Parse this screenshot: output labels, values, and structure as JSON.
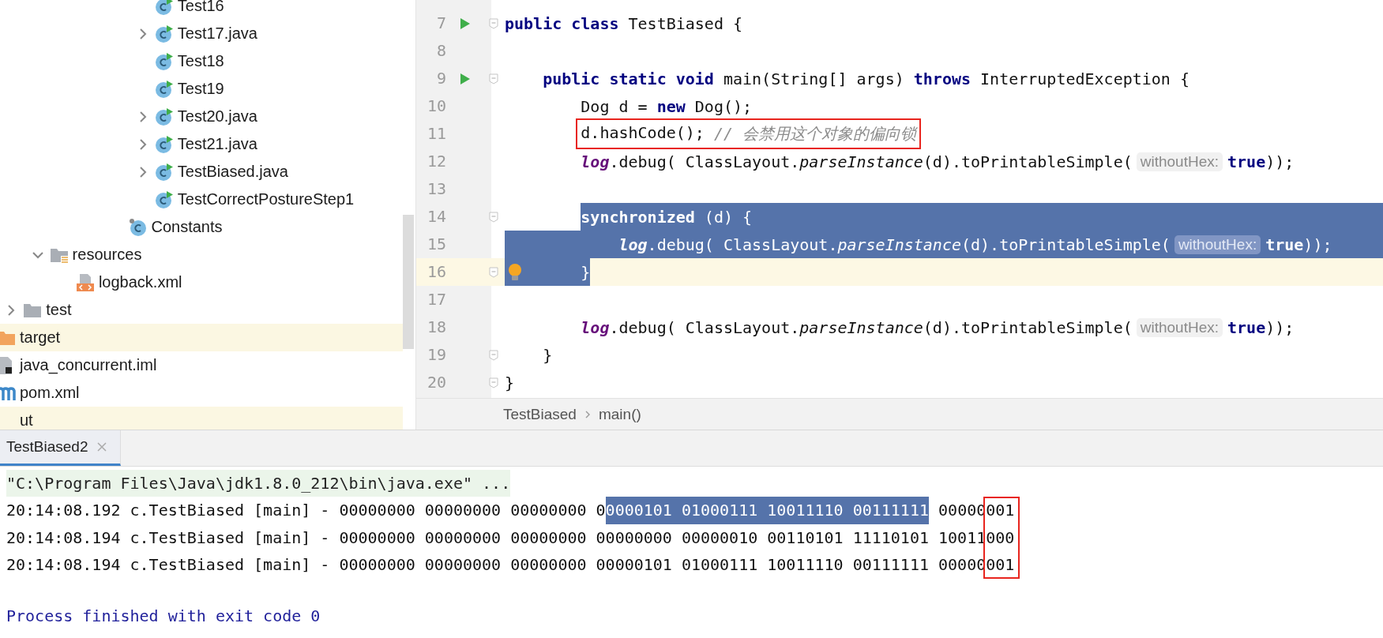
{
  "project_tree": [
    {
      "children": [
        {
          "children": [
            {
              "children": [
                {
                  "children": [
                    {
                      "children": [
                        {
                          "children": [
                            {
                              "label": "Test16",
                              "kind": "runnable-class",
                              "highlighted": false
                            },
                            {
                              "label": "Test17.java",
                              "kind": "runnable-class",
                              "expanded": false,
                              "highlighted": false
                            },
                            {
                              "label": "Test18",
                              "kind": "runnable-class",
                              "highlighted": false
                            },
                            {
                              "label": "Test19",
                              "kind": "runnable-class",
                              "highlighted": false
                            },
                            {
                              "label": "Test20.java",
                              "kind": "runnable-class",
                              "expanded": false,
                              "highlighted": false
                            },
                            {
                              "label": "Test21.java",
                              "kind": "runnable-class",
                              "expanded": false,
                              "highlighted": false
                            },
                            {
                              "label": "TestBiased.java",
                              "kind": "runnable-class",
                              "expanded": false,
                              "highlighted": false
                            },
                            {
                              "label": "TestCorrectPostureStep1",
                              "kind": "runnable-class",
                              "highlighted": false
                            }
                          ]
                        },
                        {
                          "label": "Constants",
                          "kind": "static-class",
                          "highlighted": false
                        }
                      ]
                    }
                  ]
                }
              ]
            },
            {
              "label": "resources",
              "kind": "resources-folder",
              "expanded": true,
              "highlighted": false,
              "children": [
                {
                  "label": "logback.xml",
                  "kind": "xml-file",
                  "highlighted": false
                }
              ]
            }
          ]
        },
        {
          "label": "test",
          "kind": "folder",
          "expanded": false,
          "highlighted": false
        }
      ]
    },
    {
      "label": "target",
      "kind": "orange-folder",
      "highlighted": true
    },
    {
      "label": "java_concurrent.iml",
      "kind": "iml-file",
      "highlighted": false
    },
    {
      "label": "pom.xml",
      "kind": "maven-file",
      "highlighted": false
    },
    {
      "label": "ut",
      "highlighted": true
    }
  ],
  "editor": {
    "lines": [
      {
        "number": "7",
        "runnable": true,
        "fold": true,
        "selected": false,
        "current": false,
        "boxed": false,
        "bulb": false,
        "segments": [
          {
            "kind": "code",
            "text": "**public class** TestBiased {"
          }
        ]
      },
      {
        "number": "8",
        "runnable": false,
        "fold": false,
        "selected": false,
        "current": false,
        "boxed": false,
        "bulb": false
      },
      {
        "number": "9",
        "runnable": true,
        "fold": true,
        "selected": false,
        "current": false,
        "boxed": false,
        "bulb": false,
        "segments": [
          {
            "kind": "code",
            "text": "    **public static void** main(String[] args) **throws** InterruptedException {"
          }
        ]
      },
      {
        "number": "10",
        "runnable": false,
        "fold": false,
        "selected": false,
        "current": false,
        "boxed": false,
        "bulb": false,
        "segments": [
          {
            "kind": "code",
            "text": "        Dog d = **new** Dog();"
          }
        ]
      },
      {
        "number": "11",
        "runnable": false,
        "fold": false,
        "selected": false,
        "current": false,
        "boxed": true,
        "bulb": false,
        "segments": [
          {
            "kind": "code",
            "text": "        d.hashCode();"
          },
          {
            "kind": "comment",
            "text": "// 会禁用这个对象的偏向锁"
          }
        ]
      },
      {
        "number": "12",
        "runnable": false,
        "fold": false,
        "selected": false,
        "current": false,
        "boxed": false,
        "bulb": false,
        "segments": [
          {
            "kind": "code",
            "text": "        *log*.debug( ClassLayout.*parseInstance*(d).toPrintableSimple("
          },
          {
            "kind": "hint",
            "text": "withoutHex:"
          },
          {
            "kind": "code",
            "text": "**true**));"
          }
        ]
      },
      {
        "number": "13",
        "runnable": false,
        "fold": false,
        "selected": false,
        "current": false,
        "boxed": false,
        "bulb": false
      },
      {
        "number": "14",
        "runnable": false,
        "fold": true,
        "selected": true,
        "current": false,
        "boxed": false,
        "bulb": false,
        "segments": [
          {
            "kind": "code",
            "text": "        **synchronized** (d) {"
          }
        ]
      },
      {
        "number": "15",
        "runnable": false,
        "fold": false,
        "selected": true,
        "current": false,
        "boxed": false,
        "bulb": false,
        "segments": [
          {
            "kind": "code",
            "text": "            *log*.debug( ClassLayout.*parseInstance*(d).toPrintableSimple("
          },
          {
            "kind": "hint",
            "text": "withoutHex:"
          },
          {
            "kind": "code",
            "text": "**true**));"
          }
        ]
      },
      {
        "number": "16",
        "runnable": false,
        "fold": true,
        "selected": true,
        "current": true,
        "boxed": false,
        "bulb": true,
        "segments": [
          {
            "kind": "code",
            "text": "        }"
          }
        ]
      },
      {
        "number": "17",
        "runnable": false,
        "fold": false,
        "selected": false,
        "current": false,
        "boxed": false,
        "bulb": false
      },
      {
        "number": "18",
        "runnable": false,
        "fold": false,
        "selected": false,
        "current": false,
        "boxed": false,
        "bulb": false,
        "segments": [
          {
            "kind": "code",
            "text": "        *log*.debug( ClassLayout.*parseInstance*(d).toPrintableSimple("
          },
          {
            "kind": "hint",
            "text": "withoutHex:"
          },
          {
            "kind": "code",
            "text": "**true**));"
          }
        ]
      },
      {
        "number": "19",
        "runnable": false,
        "fold": true,
        "selected": false,
        "current": false,
        "boxed": false,
        "bulb": false,
        "segments": [
          {
            "kind": "code",
            "text": "    }"
          }
        ]
      },
      {
        "number": "20",
        "runnable": false,
        "fold": true,
        "selected": false,
        "current": false,
        "boxed": false,
        "bulb": false,
        "segments": [
          {
            "kind": "code",
            "text": "}"
          }
        ]
      }
    ],
    "breadcrumbs": [
      "TestBiased",
      "main()"
    ]
  },
  "run_panel": {
    "tabs": [
      {
        "label": "TestBiased2",
        "selected": true
      }
    ],
    "command": "\"C:\\Program Files\\Java\\jdk1.8.0_212\\bin\\java.exe\" ...",
    "output": [
      {
        "segments": [
          {
            "text": "20:14:08.192 c.TestBiased [main] - 00000000 00000000 00000000 0",
            "selected": false,
            "boxed": false
          },
          {
            "text": "0000101 01000111 10011110 00111111",
            "selected": true,
            "boxed": false
          },
          {
            "text": "00000",
            "selected": false,
            "boxed": false
          },
          {
            "text": "001",
            "selected": false,
            "boxed": true
          }
        ]
      },
      {
        "segments": [
          {
            "text": "20:14:08.194 c.TestBiased [main] - 00000000 00000000 00000000 00000000 00000010 00110101 11110101 10011",
            "selected": false,
            "boxed": false
          },
          {
            "text": "000",
            "selected": false,
            "boxed": true
          }
        ]
      },
      {
        "segments": [
          {
            "text": "20:14:08.194 c.TestBiased [main] - 00000000 00000000 00000000 00000101 01000111 10011110 00111111 00000",
            "selected": false,
            "boxed": false
          },
          {
            "text": "001",
            "selected": false,
            "boxed": true
          }
        ]
      }
    ],
    "exit_message": "Process finished with exit code 0"
  }
}
